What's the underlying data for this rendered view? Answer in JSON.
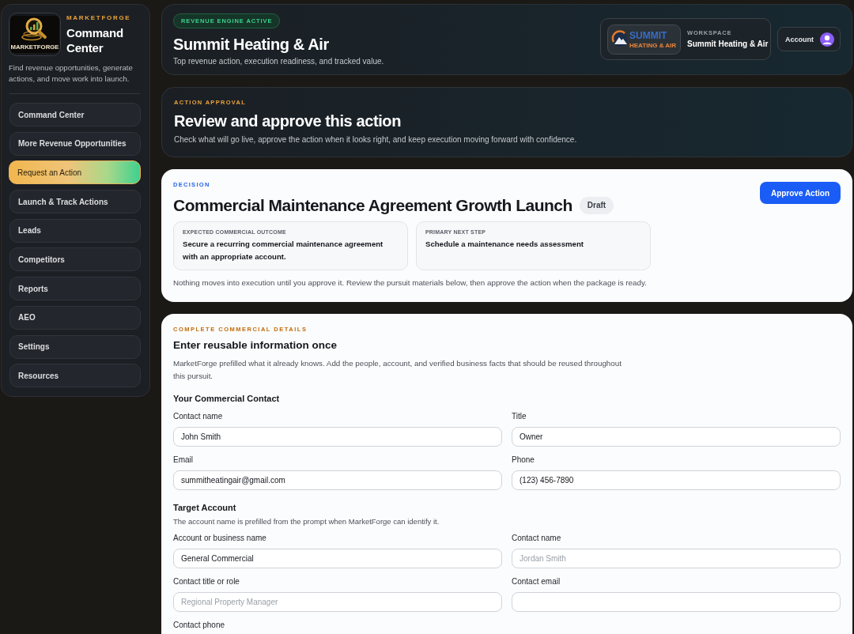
{
  "sidebar": {
    "logo_text": "MARKETFORGE",
    "brand": "MARKETFORGE",
    "title": "Command Center",
    "description": "Find revenue opportunities, generate actions, and move work into launch.",
    "nav": [
      {
        "label": "Command Center",
        "selected": false
      },
      {
        "label": "More Revenue Opportunities",
        "selected": false
      },
      {
        "label": "Request an Action",
        "selected": true
      },
      {
        "label": "Launch & Track Actions",
        "selected": false
      },
      {
        "label": "Leads",
        "selected": false
      },
      {
        "label": "Competitors",
        "selected": false
      },
      {
        "label": "Reports",
        "selected": false
      },
      {
        "label": "AEO",
        "selected": false
      },
      {
        "label": "Settings",
        "selected": false
      },
      {
        "label": "Resources",
        "selected": false
      }
    ]
  },
  "header": {
    "badge": "REVENUE ENGINE ACTIVE",
    "title": "Summit Heating & Air",
    "subtitle": "Top revenue action, execution readiness, and tracked value.",
    "workspace": {
      "logo_text": "SUMMIT",
      "logo_subtext": "HEATING & AIR",
      "label": "WORKSPACE",
      "name": "Summit Heating & Air"
    },
    "account": {
      "label": "Account"
    }
  },
  "approval": {
    "eyebrow": "ACTION APPROVAL",
    "title": "Review and approve this action",
    "description": "Check what will go live, approve the action when it looks right, and keep execution moving forward with confidence."
  },
  "decision": {
    "eyebrow": "DECISION",
    "title": "Commercial Maintenance Agreement Growth Launch",
    "status": "Draft",
    "approve_button": "Approve Action",
    "facts": [
      {
        "label": "EXPECTED COMMERCIAL OUTCOME",
        "text": "Secure a recurring commercial maintenance agreement with an appropriate account."
      },
      {
        "label": "PRIMARY NEXT STEP",
        "text": "Schedule a maintenance needs assessment"
      }
    ],
    "note": "Nothing moves into execution until you approve it. Review the pursuit materials below, then approve the action when the package is ready."
  },
  "details": {
    "eyebrow": "COMPLETE COMMERCIAL DETAILS",
    "title": "Enter reusable information once",
    "description": "MarketForge prefilled what it already knows. Add the people, account, and verified business facts that should be reused throughout this pursuit.",
    "sections": [
      {
        "title": "Your Commercial Contact",
        "fields": [
          {
            "kind": "text",
            "label": "Contact name",
            "value": "John Smith"
          },
          {
            "kind": "text",
            "label": "Title",
            "value": "Owner"
          },
          {
            "kind": "text",
            "label": "Email",
            "value": "summitheatingair@gmail.com"
          },
          {
            "kind": "text",
            "label": "Phone",
            "value": "(123) 456-7890"
          }
        ]
      },
      {
        "title": "Target Account",
        "hint": "The account name is prefilled from the prompt when MarketForge can identify it.",
        "fields": [
          {
            "kind": "text",
            "label": "Account or business name",
            "value": "General Commercial"
          },
          {
            "kind": "text",
            "label": "Contact name",
            "placeholder": "Jordan Smith"
          },
          {
            "kind": "text",
            "label": "Contact title or role",
            "placeholder": "Regional Property Manager"
          },
          {
            "kind": "text",
            "label": "Contact email"
          },
          {
            "kind": "label",
            "label": "Contact phone"
          }
        ]
      }
    ]
  }
}
